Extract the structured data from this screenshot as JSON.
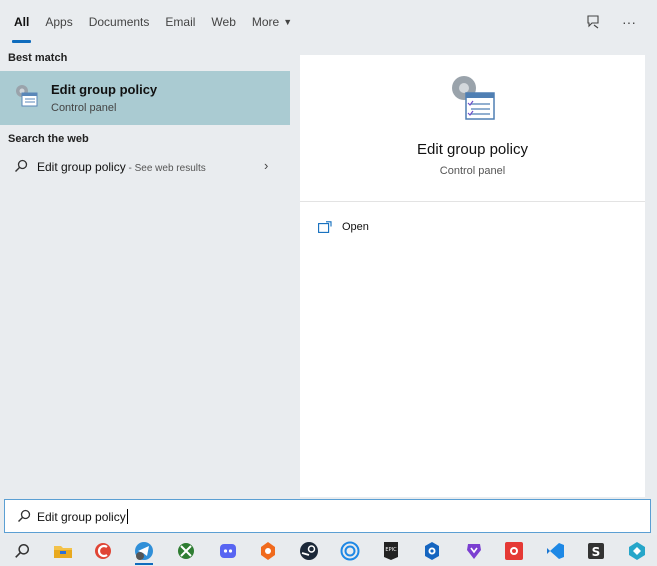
{
  "tabs": [
    {
      "label": "All",
      "active": true
    },
    {
      "label": "Apps"
    },
    {
      "label": "Documents"
    },
    {
      "label": "Email"
    },
    {
      "label": "Web"
    },
    {
      "label": "More",
      "has_dropdown": true
    }
  ],
  "top_icons": {
    "feedback": "feedback-icon",
    "more": "···"
  },
  "best_match": {
    "section_label": "Best match",
    "title": "Edit group policy",
    "subtitle": "Control panel",
    "icon": "group-policy-icon"
  },
  "search_web": {
    "section_label": "Search the web",
    "query": "Edit group policy",
    "suffix": " - See web results",
    "icon": "search-icon"
  },
  "detail": {
    "title": "Edit group policy",
    "subtitle": "Control panel",
    "actions": [
      {
        "label": "Open",
        "icon": "open-window-icon"
      }
    ]
  },
  "search_box": {
    "value": "Edit group policy",
    "icon": "search-icon"
  },
  "taskbar": {
    "items": [
      {
        "name": "search",
        "icon": "search-icon"
      },
      {
        "name": "file-explorer",
        "icon": "folder-icon"
      },
      {
        "name": "ccleaner",
        "icon": "ccleaner-icon"
      },
      {
        "name": "browser-telegram",
        "icon": "telegram-icon"
      },
      {
        "name": "xbox",
        "icon": "xbox-icon"
      },
      {
        "name": "discord",
        "icon": "discord-icon"
      },
      {
        "name": "app-orange",
        "icon": "orange-app-icon"
      },
      {
        "name": "steam",
        "icon": "steam-icon"
      },
      {
        "name": "ubisoft",
        "icon": "ubisoft-icon"
      },
      {
        "name": "epic-games",
        "icon": "epic-games-icon"
      },
      {
        "name": "app-blue",
        "icon": "blue-hex-icon"
      },
      {
        "name": "brave",
        "icon": "brave-icon"
      },
      {
        "name": "app-red",
        "icon": "red-app-icon"
      },
      {
        "name": "vscode",
        "icon": "vscode-icon"
      },
      {
        "name": "app-s",
        "icon": "s-app-icon"
      },
      {
        "name": "app-teal",
        "icon": "teal-app-icon"
      }
    ]
  },
  "colors": {
    "accent": "#0f6cbd",
    "selected_bg": "#aacbd2",
    "pane_bg": "#e9ecef"
  }
}
